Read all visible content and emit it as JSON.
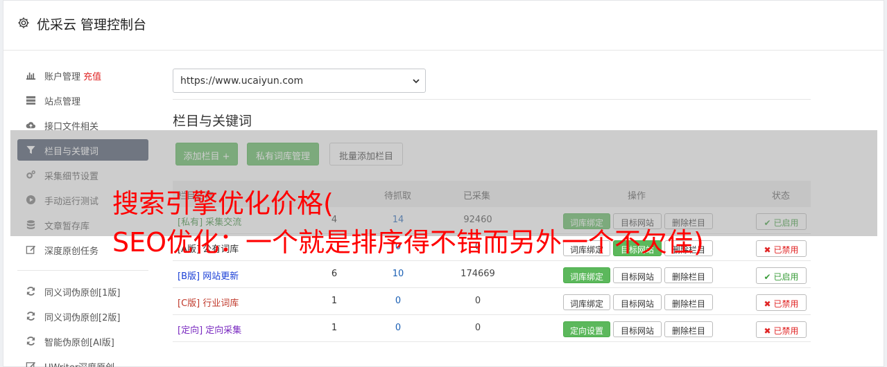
{
  "header": {
    "title": "优采云 管理控制台"
  },
  "sidebar": {
    "items": [
      {
        "label": "账户管理",
        "extra": "充值",
        "icon": "bar-chart-icon"
      },
      {
        "label": "站点管理",
        "icon": "server-icon"
      },
      {
        "label": "接口文件相关",
        "icon": "cloud-upload-icon"
      },
      {
        "label": "栏目与关键词",
        "icon": "filter-icon",
        "active": true
      },
      {
        "label": "采集细节设置",
        "icon": "cogs-icon"
      },
      {
        "label": "手动运行测试",
        "icon": "play-circle-icon"
      },
      {
        "label": "文章暂存库",
        "icon": "database-icon"
      },
      {
        "label": "深度原创任务",
        "icon": "edit-icon"
      }
    ],
    "items2": [
      {
        "label": "同义词伪原创[1版]",
        "icon": "refresh-icon"
      },
      {
        "label": "同义词伪原创[2版]",
        "icon": "refresh-icon"
      },
      {
        "label": "智能伪原创[AI版]",
        "icon": "refresh-icon"
      },
      {
        "label": "UWriter深度原创",
        "icon": "edit-icon"
      }
    ]
  },
  "main": {
    "site_select": "https://www.ucaiyun.com",
    "section_title": "栏目与关键词",
    "buttons": {
      "add": "添加栏目 +",
      "private": "私有词库管理",
      "batch": "批量添加栏目"
    },
    "table": {
      "headers": [
        "栏目名称",
        "待抓取",
        "已采集",
        "操作",
        "状态"
      ],
      "rows": [
        {
          "tag": "[私有]",
          "name": "采集交流",
          "n1": "4",
          "n2": "14",
          "n3": "92460",
          "b1": "词库绑定",
          "b2": "目标网站",
          "b3": "删除栏目",
          "status": "已启用"
        },
        {
          "tag": "[A版]",
          "name": "公有词库",
          "n1": "",
          "n2": "0",
          "n3": "0",
          "b1": "词库绑定",
          "b2": "目标网站",
          "b3": "删除栏目",
          "status": "已禁用"
        },
        {
          "tag": "[B版]",
          "name": "网站更新",
          "n1": "6",
          "n2": "10",
          "n3": "174669",
          "b1": "词库绑定",
          "b2": "目标网站",
          "b3": "删除栏目",
          "status": "已启用"
        },
        {
          "tag": "[C版]",
          "name": "行业词库",
          "n1": "1",
          "n2": "0",
          "n3": "0",
          "b1": "词库绑定",
          "b2": "目标网站",
          "b3": "删除栏目",
          "status": "已禁用"
        },
        {
          "tag": "[定向]",
          "name": "定向采集",
          "n1": "1",
          "n2": "0",
          "n3": "0",
          "b1": "定向设置",
          "b2": "目标网站",
          "b3": "删除栏目",
          "status": "已禁用"
        }
      ]
    }
  },
  "overlay": {
    "line1": "搜索引擎优化价格(",
    "line2": "SEO优化：一个就是排序得不错而另外一个不欠佳)"
  },
  "colors": {
    "green": "#5cb85c",
    "sidebar_active": "#455066",
    "overlay_text": "#ff0000",
    "link_blue": "#1a5fb4"
  }
}
